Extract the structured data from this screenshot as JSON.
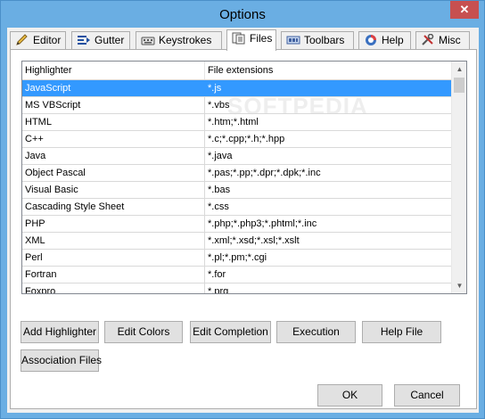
{
  "window": {
    "title": "Options"
  },
  "tabs": [
    {
      "label": "Editor",
      "icon": "pencil-icon"
    },
    {
      "label": "Gutter",
      "icon": "gutter-icon"
    },
    {
      "label": "Keystrokes",
      "icon": "keyboard-icon"
    },
    {
      "label": "Files",
      "icon": "files-icon",
      "active": true
    },
    {
      "label": "Toolbars",
      "icon": "toolbar-icon"
    },
    {
      "label": "Help",
      "icon": "help-icon"
    },
    {
      "label": "Misc",
      "icon": "tools-icon"
    }
  ],
  "table": {
    "headers": [
      "Highlighter",
      "File extensions"
    ],
    "rows": [
      [
        "JavaScript",
        "*.js"
      ],
      [
        "MS VBScript",
        "*.vbs"
      ],
      [
        "HTML",
        "*.htm;*.html"
      ],
      [
        "C++",
        "*.c;*.cpp;*.h;*.hpp"
      ],
      [
        "Java",
        "*.java"
      ],
      [
        "Object Pascal",
        "*.pas;*.pp;*.dpr;*.dpk;*.inc"
      ],
      [
        "Visual Basic",
        "*.bas"
      ],
      [
        "Cascading Style Sheet",
        "*.css"
      ],
      [
        "PHP",
        "*.php;*.php3;*.phtml;*.inc"
      ],
      [
        "XML",
        "*.xml;*.xsd;*.xsl;*.xslt"
      ],
      [
        "Perl",
        "*.pl;*.pm;*.cgi"
      ],
      [
        "Fortran",
        "*.for"
      ],
      [
        "Foxpro",
        "*.prg"
      ]
    ],
    "selected_row": "JavaScript"
  },
  "watermark": "SOFTPEDIA",
  "buttons": {
    "add_highlighter": "Add Highlighter",
    "edit_colors": "Edit Colors",
    "edit_completion": "Edit Completion",
    "execution": "Execution",
    "help_file": "Help File",
    "association_files": "Association Files",
    "ok": "OK",
    "cancel": "Cancel"
  },
  "colors": {
    "selection": "#3399ff",
    "titlebar": "#6aaee3",
    "close": "#c75050"
  }
}
